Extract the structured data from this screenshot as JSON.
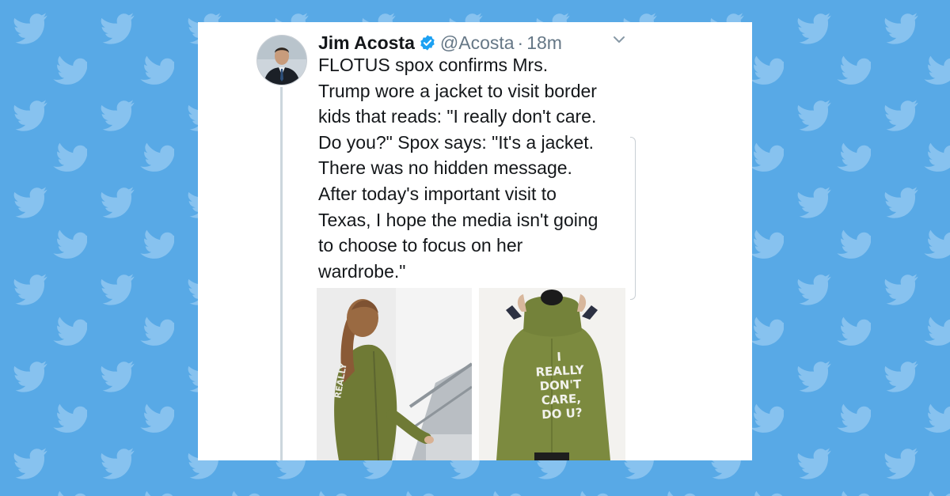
{
  "background": {
    "color": "#58a9e6",
    "pattern_icon": "twitter-bird-icon"
  },
  "tweet": {
    "author_name": "Jim Acosta",
    "verified_icon": "verified-badge-icon",
    "handle": "@Acosta",
    "separator": "·",
    "time": "18m",
    "menu_icon": "chevron-down-icon",
    "avatar_icon": "profile-photo",
    "text_lines": [
      "FLOTUS spox confirms Mrs.",
      "Trump wore a jacket to visit border",
      "kids that reads: \"I really don't care.",
      "Do you?\" Spox says: \"It's a jacket.",
      "There was no hidden message.",
      "After today's important visit to",
      "Texas, I hope the media isn't going",
      "to choose to focus on her",
      "wardrobe.\""
    ],
    "media": {
      "jacket_text_lines": [
        "I",
        "REALLY",
        "DON'T",
        "CARE,",
        "DO U?"
      ]
    }
  },
  "colors": {
    "link_blue": "#1da1f2",
    "text": "#14171a",
    "secondary_text": "#657786",
    "jacket_green": "#7c8a3f"
  }
}
